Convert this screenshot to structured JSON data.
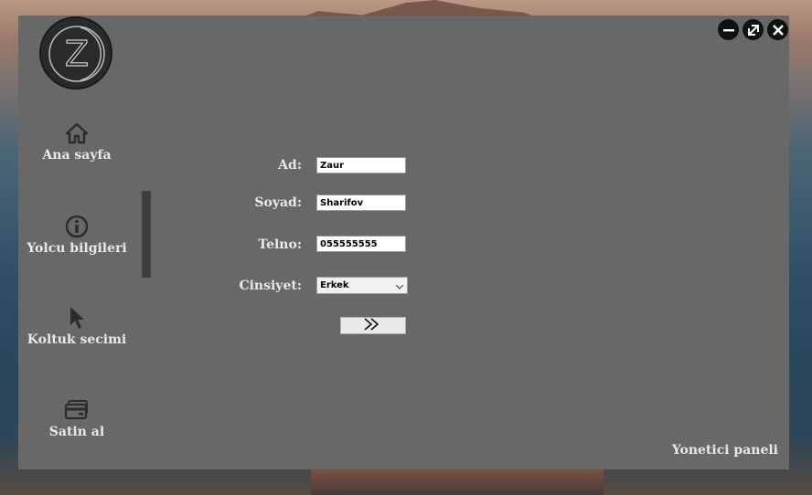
{
  "window_controls": {
    "minimize": "minimize-icon",
    "restore": "restore-icon",
    "close": "close-icon"
  },
  "logo": {
    "letter": "Z"
  },
  "sidebar": {
    "items": [
      {
        "label": "Ana sayfa",
        "icon": "home-icon"
      },
      {
        "label": "Yolcu bilgileri",
        "icon": "info-icon"
      },
      {
        "label": "Koltuk secimi",
        "icon": "cursor-icon"
      },
      {
        "label": "Satin al",
        "icon": "credit-card-icon"
      }
    ]
  },
  "form": {
    "name_label": "Ad:",
    "name_value": "Zaur",
    "surname_label": "Soyad:",
    "surname_value": "Sharifov",
    "phone_label": "Telno:",
    "phone_value": "055555555",
    "gender_label": "Cinsiyet:",
    "gender_value": "Erkek",
    "next_icon": "double-chevron-right-icon"
  },
  "footer": {
    "admin_label": "Yonetici paneli"
  },
  "colors": {
    "window_bg": "#686868",
    "text": "#e8e8e8",
    "active_bar": "#3f3f3f"
  }
}
